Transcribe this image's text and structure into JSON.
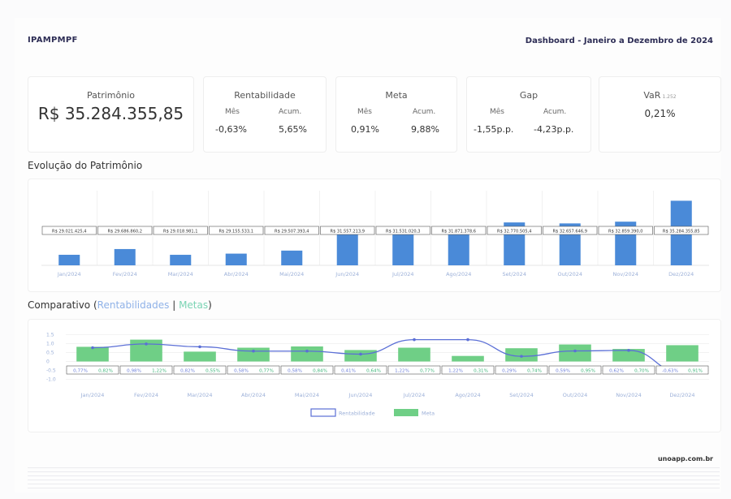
{
  "header": {
    "brand": "IPAMPMPF",
    "title": "Dashboard - Janeiro a Dezembro de 2024"
  },
  "cards": {
    "patrimonio": {
      "title": "Patrimônio",
      "value": "R$ 35.284.355,85"
    },
    "rentabilidade": {
      "title": "Rentabilidade",
      "mes_label": "Mês",
      "acum_label": "Acum.",
      "mes": "-0,63%",
      "acum": "5,65%"
    },
    "meta": {
      "title": "Meta",
      "mes_label": "Mês",
      "acum_label": "Acum.",
      "mes": "0,91%",
      "acum": "9,88%"
    },
    "gap": {
      "title": "Gap",
      "mes_label": "Mês",
      "acum_label": "Acum.",
      "mes": "-1,55p.p.",
      "acum": "-4,23p.p."
    },
    "var": {
      "title": "VaR",
      "sub": "1.252",
      "value": "0,21%"
    }
  },
  "sections": {
    "evolucao": "Evolução do Patrimônio",
    "comparativo": "Comparativo",
    "comparativo_open": "(",
    "comparativo_blue": "Rentabilidades",
    "comparativo_sep": "|",
    "comparativo_green": "Metas",
    "comparativo_close": ")"
  },
  "footer": {
    "brand": "unoapp.com.br"
  },
  "chart_data": [
    {
      "type": "bar",
      "categories": [
        "Jan/2024",
        "Fev/2024",
        "Mar/2024",
        "Abr/2024",
        "Mai/2024",
        "Jun/2024",
        "Jul/2024",
        "Ago/2024",
        "Set/2024",
        "Out/2024",
        "Nov/2024",
        "Dez/2024"
      ],
      "values": [
        29021425,
        29686860,
        29018981,
        29155533,
        29507393,
        31557213,
        31531020,
        31871378,
        32770505,
        32657646,
        32859390,
        35284355
      ],
      "labels": [
        "R$ 29.021.425,4",
        "R$ 29.686.860,2",
        "R$ 29.018.981,1",
        "R$ 29.155.533,1",
        "R$ 29.507.393,4",
        "R$ 31.557.213,9",
        "R$ 31.531.020,3",
        "R$ 31.871.378,6",
        "R$ 32.770.505,4",
        "R$ 32.657.646,9",
        "R$ 32.859.390,0",
        "R$ 35.284.355,85"
      ],
      "color": "#4a8ad8",
      "grid": true
    },
    {
      "type": "bar",
      "categories": [
        "Jan/2024",
        "Fev/2024",
        "Mar/2024",
        "Abr/2024",
        "Mai/2024",
        "Jun/2024",
        "Jul/2024",
        "Ago/2024",
        "Set/2024",
        "Out/2024",
        "Nov/2024",
        "Dez/2024"
      ],
      "yticks": [
        "1.5",
        "1.0",
        "0.5",
        "0",
        "-0.5",
        "-1.0"
      ],
      "ylim": [
        -1.2,
        1.7
      ],
      "series": [
        {
          "name": "Rentabilidade",
          "kind": "line",
          "color": "#5b6fd6",
          "values": [
            0.77,
            0.98,
            0.82,
            0.58,
            0.58,
            0.41,
            1.22,
            1.22,
            0.29,
            0.59,
            0.62,
            -0.63
          ],
          "labels": [
            "0,77%",
            "0,98%",
            "0,82%",
            "0,58%",
            "0,58%",
            "0,41%",
            "1,22%",
            "1,22%",
            "0,29%",
            "0,59%",
            "0,62%",
            "-0,63%"
          ]
        },
        {
          "name": "Meta",
          "kind": "bar",
          "color": "#6fcf86",
          "values": [
            0.82,
            1.22,
            0.55,
            0.77,
            0.84,
            0.64,
            0.77,
            0.31,
            0.74,
            0.95,
            0.7,
            0.91
          ],
          "labels": [
            "0,82%",
            "1,22%",
            "0,55%",
            "0,77%",
            "0,84%",
            "0,64%",
            "0,77%",
            "0,31%",
            "0,74%",
            "0,95%",
            "0,70%",
            "0,91%"
          ]
        }
      ],
      "legend": "bottom-center",
      "grid": true
    }
  ]
}
